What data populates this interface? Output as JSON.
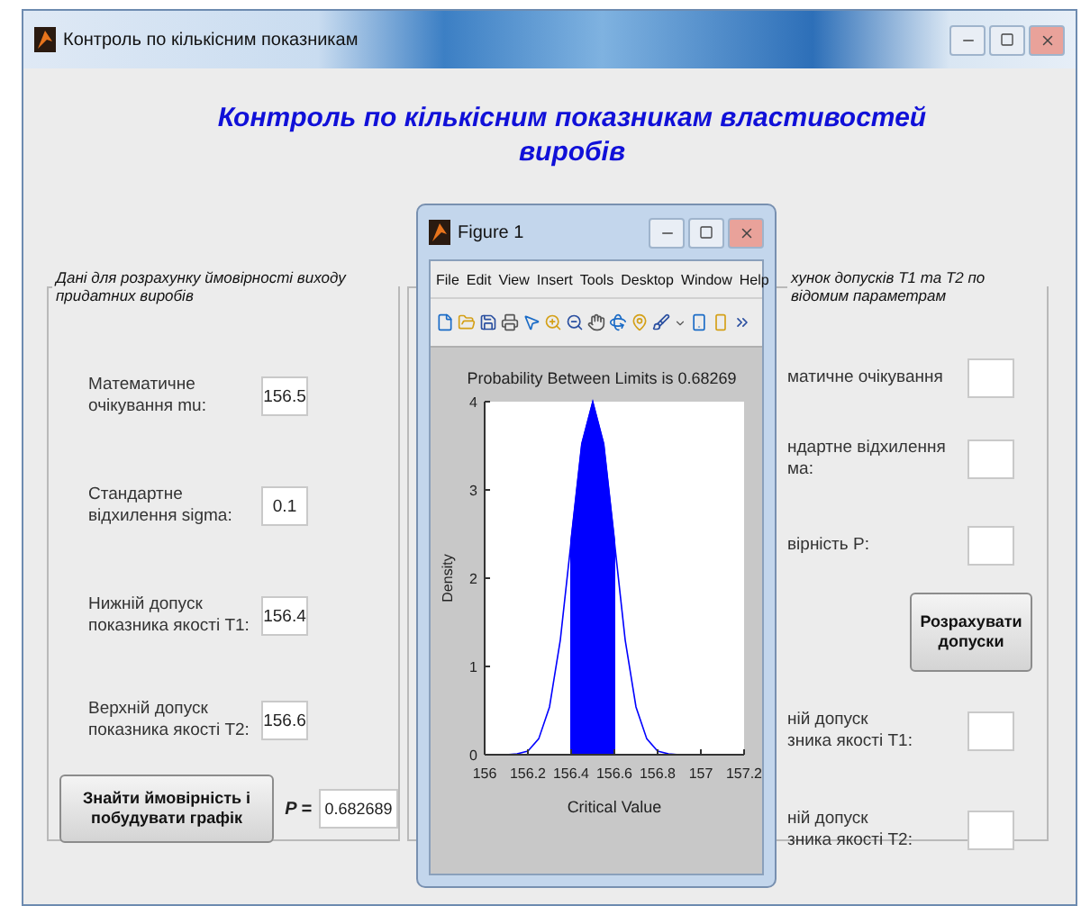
{
  "window": {
    "title": "Контроль по кількісним показникам"
  },
  "heading": "Контроль по кількісним показникам властивостей виробів",
  "left_panel": {
    "title": "Дані для розрахунку ймовірності виходу придатних виробів",
    "fields": [
      {
        "label": "Математичне очікування mu:",
        "value": "156.5"
      },
      {
        "label": "Стандартне відхилення sigma:",
        "value": "0.1"
      },
      {
        "label": "Нижній допуск показника якості T1:",
        "value": "156.4"
      },
      {
        "label": "Верхній допуск показника якості T2:",
        "value": "156.6"
      }
    ],
    "button": "Знайти ймовірність і побудувати графік",
    "result": {
      "label": "P =",
      "value": "0.682689"
    }
  },
  "right_panel": {
    "title": "хунок допусків T1 та T2 по відомим параметрам",
    "rows": [
      {
        "kind": "field",
        "lines": [
          "матичне очікування"
        ]
      },
      {
        "kind": "field",
        "lines": [
          "ндартне відхилення",
          "ма:"
        ]
      },
      {
        "kind": "field",
        "lines": [
          "вірність P:"
        ]
      },
      {
        "kind": "button",
        "label": "Розрахувати допуски"
      },
      {
        "kind": "field",
        "lines": [
          "ній допуск",
          "зника якості T1:"
        ]
      },
      {
        "kind": "field",
        "lines": [
          "ній допуск",
          "зника якості T2:"
        ]
      }
    ]
  },
  "figure": {
    "title": "Figure 1",
    "menu": [
      "File",
      "Edit",
      "View",
      "Insert",
      "Tools",
      "Desktop",
      "Window",
      "Help"
    ],
    "chart_data": {
      "type": "line",
      "title": "Probability Between Limits is 0.68269",
      "xlabel": "Critical Value",
      "ylabel": "Density",
      "x": [
        156.1,
        156.15,
        156.2,
        156.25,
        156.3,
        156.35,
        156.4,
        156.45,
        156.5,
        156.55,
        156.6,
        156.65,
        156.7,
        156.75,
        156.8,
        156.85,
        156.9
      ],
      "series": [
        {
          "type": "line",
          "color": "#0000ff",
          "values": [
            0,
            0.01,
            0.04,
            0.18,
            0.54,
            1.3,
            2.42,
            3.52,
            3.99,
            3.52,
            2.42,
            1.3,
            0.54,
            0.18,
            0.04,
            0.01,
            0
          ]
        },
        {
          "type": "area",
          "color": "#0000ff",
          "values": [
            null,
            null,
            null,
            null,
            null,
            null,
            2.42,
            3.52,
            3.99,
            3.52,
            2.42,
            null,
            null,
            null,
            null,
            null,
            null
          ]
        }
      ],
      "xlim": [
        156,
        157.2
      ],
      "ylim": [
        0,
        4
      ],
      "xticks": [
        156,
        156.2,
        156.4,
        156.6,
        156.8,
        157,
        157.2
      ],
      "yticks": [
        0,
        1,
        2,
        3,
        4
      ]
    }
  }
}
